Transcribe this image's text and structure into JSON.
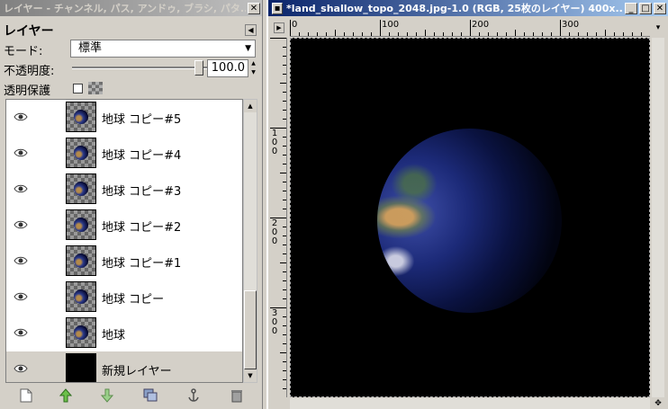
{
  "layers_window": {
    "title": "レイヤー - チャンネル, パス, アンドゥ, ブラシ, パタ...",
    "panel_title": "レイヤー",
    "mode_label": "モード:",
    "mode_value": "標準",
    "opacity_label": "不透明度:",
    "opacity_value": "100.0",
    "opacity_level": 1.0,
    "lock_label": "透明保護",
    "lock_checked": false,
    "layers": [
      {
        "name": "地球 コピー#5",
        "visible": true,
        "thumb": "globe"
      },
      {
        "name": "地球 コピー#4",
        "visible": true,
        "thumb": "globe"
      },
      {
        "name": "地球 コピー#3",
        "visible": true,
        "thumb": "globe"
      },
      {
        "name": "地球 コピー#2",
        "visible": true,
        "thumb": "globe"
      },
      {
        "name": "地球 コピー#1",
        "visible": true,
        "thumb": "globe"
      },
      {
        "name": "地球 コピー",
        "visible": true,
        "thumb": "globe"
      },
      {
        "name": "地球",
        "visible": true,
        "thumb": "globe"
      },
      {
        "name": "新規レイヤー",
        "visible": true,
        "thumb": "black",
        "selected": true
      }
    ],
    "toolbar_icons": [
      "new-layer-icon",
      "raise-layer-icon",
      "lower-layer-icon",
      "duplicate-layer-icon",
      "anchor-layer-icon",
      "delete-layer-icon"
    ]
  },
  "image_window": {
    "title": "*land_shallow_topo_2048.jpg-1.0 (RGB, 25枚のレイヤー) 400x...",
    "hruler_labels": [
      "0",
      "100",
      "200",
      "300"
    ],
    "vruler_labels": [
      "100",
      "200",
      "300"
    ]
  },
  "colors": {
    "selection": "#d4d0c8",
    "active_title": "#0a246a",
    "canvas": "#000000"
  }
}
